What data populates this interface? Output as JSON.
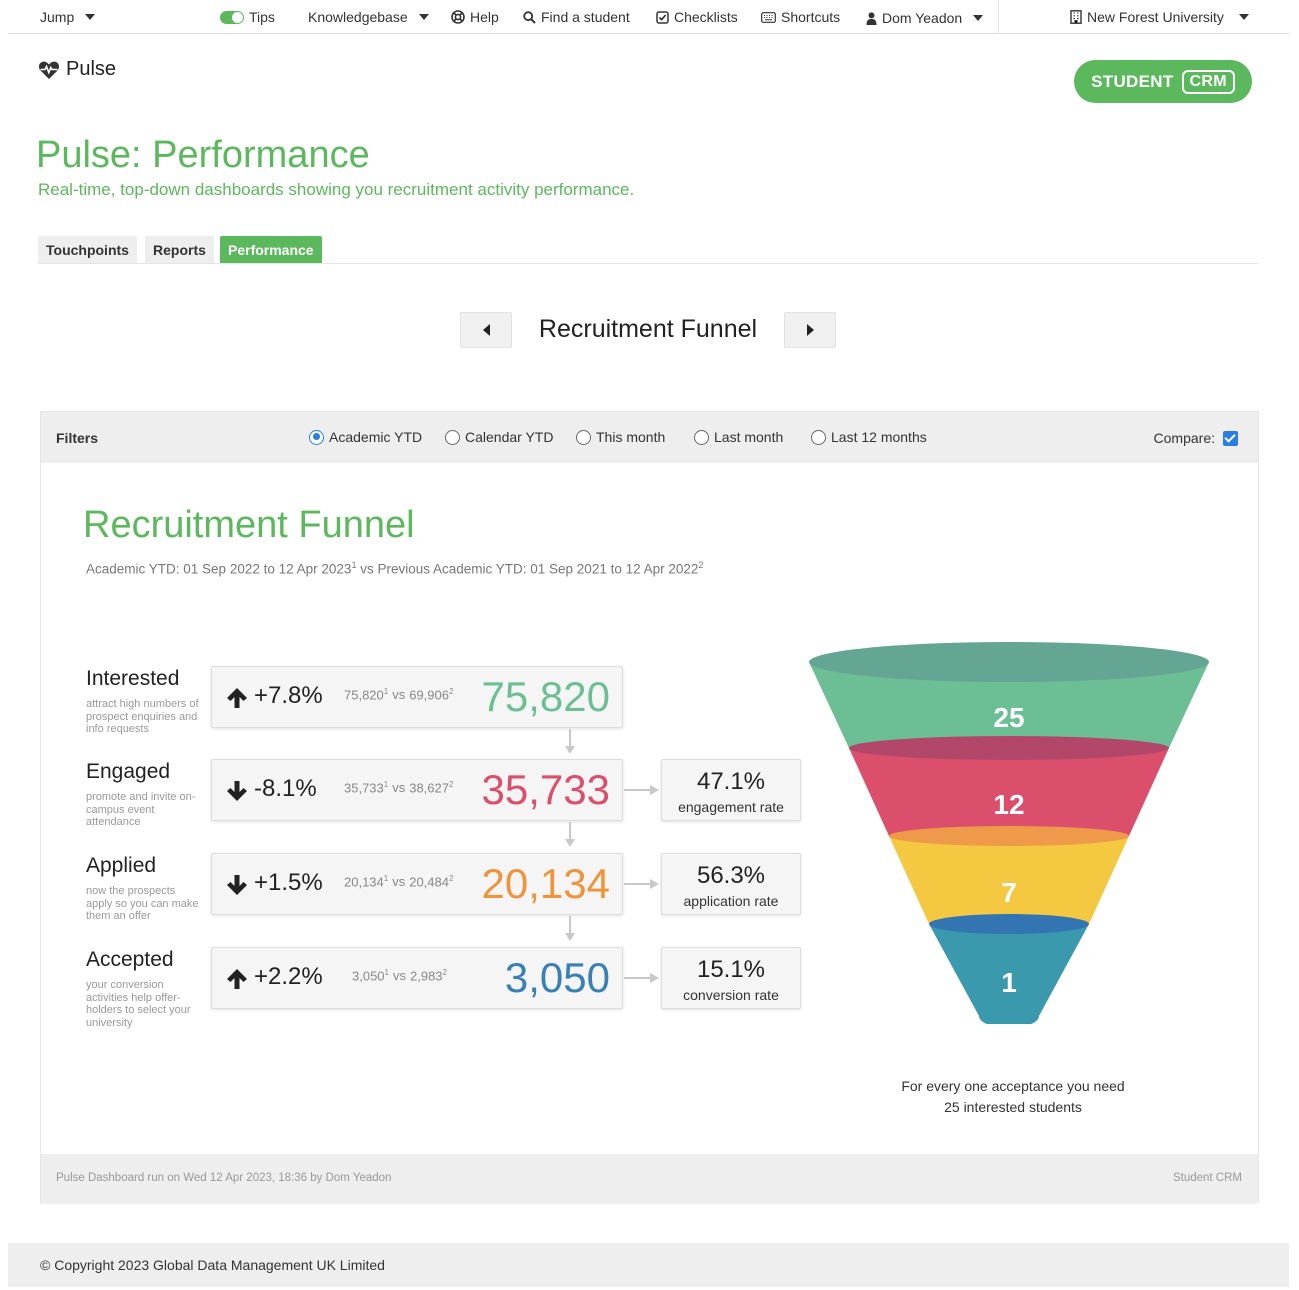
{
  "nav": {
    "jump": "Jump",
    "tips": "Tips",
    "knowledgebase": "Knowledgebase",
    "help": "Help",
    "find_student": "Find a student",
    "checklists": "Checklists",
    "shortcuts": "Shortcuts",
    "user": "Dom Yeadon",
    "institution": "New Forest University"
  },
  "header": {
    "brand": "Pulse",
    "badge_left": "STUDENT",
    "badge_right": "CRM",
    "title": "Pulse: Performance",
    "subtitle": "Real-time, top-down dashboards showing you recruitment activity performance."
  },
  "tabs": [
    {
      "label": "Touchpoints",
      "active": false
    },
    {
      "label": "Reports",
      "active": false
    },
    {
      "label": "Performance",
      "active": true
    }
  ],
  "selector": {
    "title": "Recruitment Funnel"
  },
  "filters": {
    "label": "Filters",
    "options": [
      {
        "label": "Academic YTD",
        "checked": true
      },
      {
        "label": "Calendar YTD",
        "checked": false
      },
      {
        "label": "This month",
        "checked": false
      },
      {
        "label": "Last month",
        "checked": false
      },
      {
        "label": "Last 12 months",
        "checked": false
      }
    ],
    "compare_label": "Compare:",
    "compare_checked": true
  },
  "funnel": {
    "heading": "Recruitment Funnel",
    "range_current": "Academic YTD: 01 Sep 2022 to 12 Apr 2023",
    "range_sep": " vs Previous Academic YTD: 01 Sep 2021 to 12 Apr 2022",
    "sup1": "1",
    "sup2": "2",
    "vs": "vs",
    "stages": [
      {
        "name": "Interested",
        "desc": "attract high numbers of prospect enquiries and info requests",
        "direction": "up",
        "change": "+7.8%",
        "current": "75,820",
        "previous": "69,906",
        "value": "75,820",
        "color": "#6cbf94"
      },
      {
        "name": "Engaged",
        "desc": "promote and invite on-campus event attendance",
        "direction": "down",
        "change": "-8.1%",
        "current": "35,733",
        "previous": "38,627",
        "value": "35,733",
        "color": "#dc4f6c"
      },
      {
        "name": "Applied",
        "desc": "now the prospects apply so you can make them an offer",
        "direction": "down",
        "change": "+1.5%",
        "current": "20,134",
        "previous": "20,484",
        "value": "20,134",
        "color": "#f0943c"
      },
      {
        "name": "Accepted",
        "desc": "your conversion activities help offer-holders to select your university",
        "direction": "up",
        "change": "+2.2%",
        "current": "3,050",
        "previous": "2,983",
        "value": "3,050",
        "color": "#3880b5"
      }
    ],
    "rates": [
      {
        "value": "47.1%",
        "label": "engagement rate"
      },
      {
        "value": "56.3%",
        "label": "application rate"
      },
      {
        "value": "15.1%",
        "label": "conversion rate"
      }
    ],
    "ratios": [
      {
        "label": "25",
        "color": "#6cbf94",
        "top_color": "#64a593"
      },
      {
        "label": "12",
        "color": "#dc4f6c",
        "top_color": "#b3476a"
      },
      {
        "label": "7",
        "color": "#f5c842",
        "top_color": "#ee9a4a"
      },
      {
        "label": "1",
        "color": "#3b99ad",
        "top_color": "#3374b3"
      }
    ],
    "note_line1": "For every one acceptance you need",
    "note_line2": "25 interested students"
  },
  "card_footer": {
    "left": "Pulse Dashboard run on Wed 12 Apr 2023, 18:36 by Dom Yeadon",
    "right": "Student CRM"
  },
  "copyright": "© Copyright 2023 Global Data Management UK Limited",
  "icons": {
    "heartbeat": "heartbeat-icon",
    "lifebuoy": "lifebuoy-icon",
    "search": "search-icon",
    "checklist": "check-square-icon",
    "keyboard": "keyboard-icon",
    "user": "user-icon",
    "building": "building-icon"
  }
}
